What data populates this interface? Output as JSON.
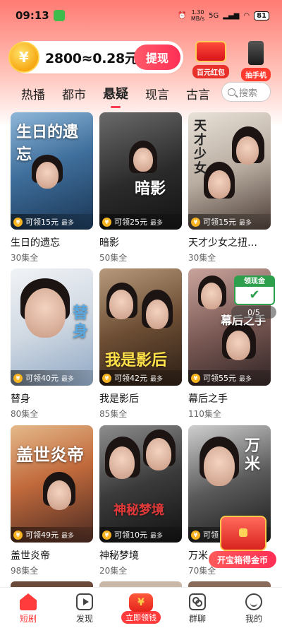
{
  "status_bar": {
    "time": "09:13",
    "net_speed": "1.30",
    "net_unit": "MB/s",
    "signal": "5G",
    "battery": "81"
  },
  "coin_bar": {
    "coin_symbol": "¥",
    "amount_text": "2800≈0.28元",
    "withdraw_label": "提现"
  },
  "promos": [
    {
      "label": "百元红包"
    },
    {
      "label": "抽手机"
    }
  ],
  "tabs": [
    {
      "label": "热播"
    },
    {
      "label": "都市"
    },
    {
      "label": "悬疑",
      "active": true
    },
    {
      "label": "现言"
    },
    {
      "label": "古言"
    }
  ],
  "search": {
    "placeholder": "搜索"
  },
  "cards": [
    {
      "title": "生日的遗忘",
      "episodes": "30集全",
      "poster_text": "生日的遗忘",
      "reward": "可领15元",
      "most": "最多"
    },
    {
      "title": "暗影",
      "episodes": "50集全",
      "poster_text": "暗影",
      "reward": "可领25元",
      "most": "最多"
    },
    {
      "title": "天才少女之扭…",
      "episodes": "30集全",
      "poster_text": "天才少女",
      "reward": "可领15元",
      "most": "最多"
    },
    {
      "title": "替身",
      "episodes": "80集全",
      "poster_text": "替身",
      "reward": "可领40元",
      "most": "最多"
    },
    {
      "title": "我是影后",
      "episodes": "85集全",
      "poster_text": "我是影后",
      "reward": "可领42元",
      "most": "最多"
    },
    {
      "title": "幕后之手",
      "episodes": "110集全",
      "poster_text": "幕后之手",
      "reward": "可领55元",
      "most": "最多"
    },
    {
      "title": "盖世炎帝",
      "episodes": "98集全",
      "poster_text": "盖世炎帝",
      "reward": "可领49元",
      "most": "最多"
    },
    {
      "title": "神秘梦境",
      "episodes": "20集全",
      "poster_text": "神秘梦境",
      "reward": "可领10元",
      "most": "最多"
    },
    {
      "title": "万米…",
      "episodes": "70集全",
      "poster_text": "万米",
      "reward": "可领",
      "most": ""
    }
  ],
  "floating": {
    "gift_label": "领现金",
    "counter": "0/5",
    "chest_label": "开宝箱得金币"
  },
  "bottom_nav": [
    {
      "label": "短剧",
      "active": true
    },
    {
      "label": "发现"
    },
    {
      "label": "立即领钱"
    },
    {
      "label": "群聊"
    },
    {
      "label": "我的"
    }
  ]
}
